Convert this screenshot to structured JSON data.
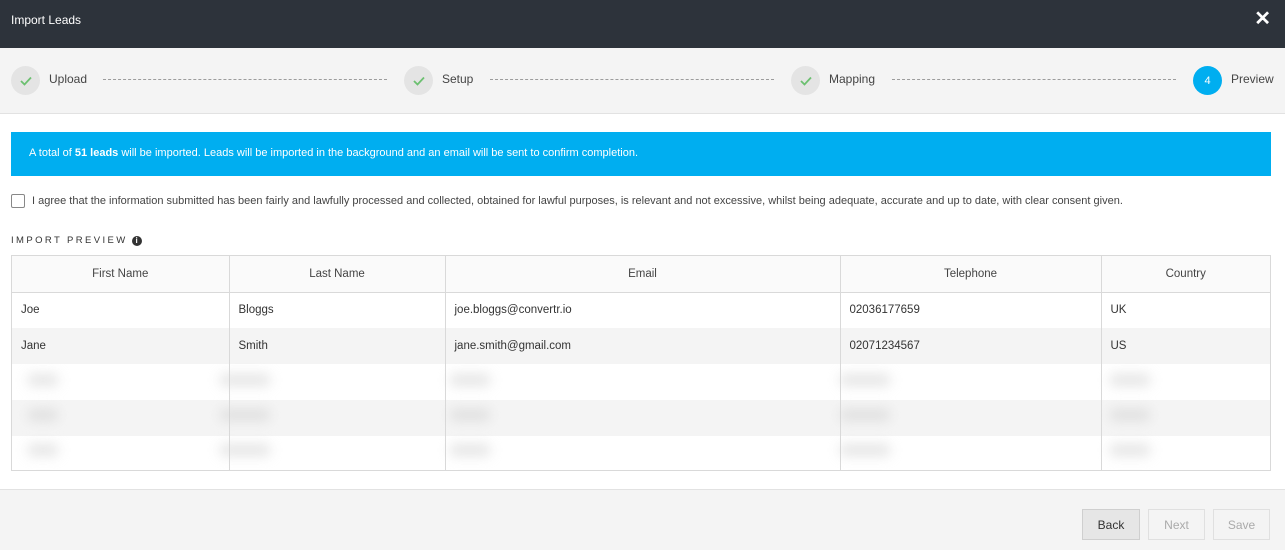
{
  "header": {
    "title": "Import Leads",
    "close_icon": "✕"
  },
  "steps": [
    {
      "label": "Upload",
      "state": "done"
    },
    {
      "label": "Setup",
      "state": "done"
    },
    {
      "label": "Mapping",
      "state": "done"
    },
    {
      "label": "Preview",
      "number": "4",
      "state": "active"
    }
  ],
  "banner": {
    "prefix": "A total of ",
    "count": "51 leads",
    "suffix": " will be imported. Leads will be imported in the background and an email will be sent to confirm completion."
  },
  "consent": {
    "text": "I agree that the information submitted has been fairly and lawfully processed and collected, obtained for lawful purposes, is relevant and not excessive, whilst being adequate, accurate and up to date, with clear consent given."
  },
  "preview": {
    "title": "IMPORT PREVIEW",
    "info_icon": "i",
    "columns": [
      "First Name",
      "Last Name",
      "Email",
      "Telephone",
      "Country"
    ],
    "rows": [
      [
        "Joe",
        "Bloggs",
        "joe.bloggs@convertr.io",
        "02036177659",
        "UK"
      ],
      [
        "Jane",
        "Smith",
        "jane.smith@gmail.com",
        "02071234567",
        "US"
      ]
    ]
  },
  "footer": {
    "back_label": "Back",
    "next_label": "Next",
    "save_label": "Save"
  },
  "colors": {
    "header_bg": "#2d333b",
    "accent": "#00aef0",
    "check_green": "#6cc070"
  }
}
